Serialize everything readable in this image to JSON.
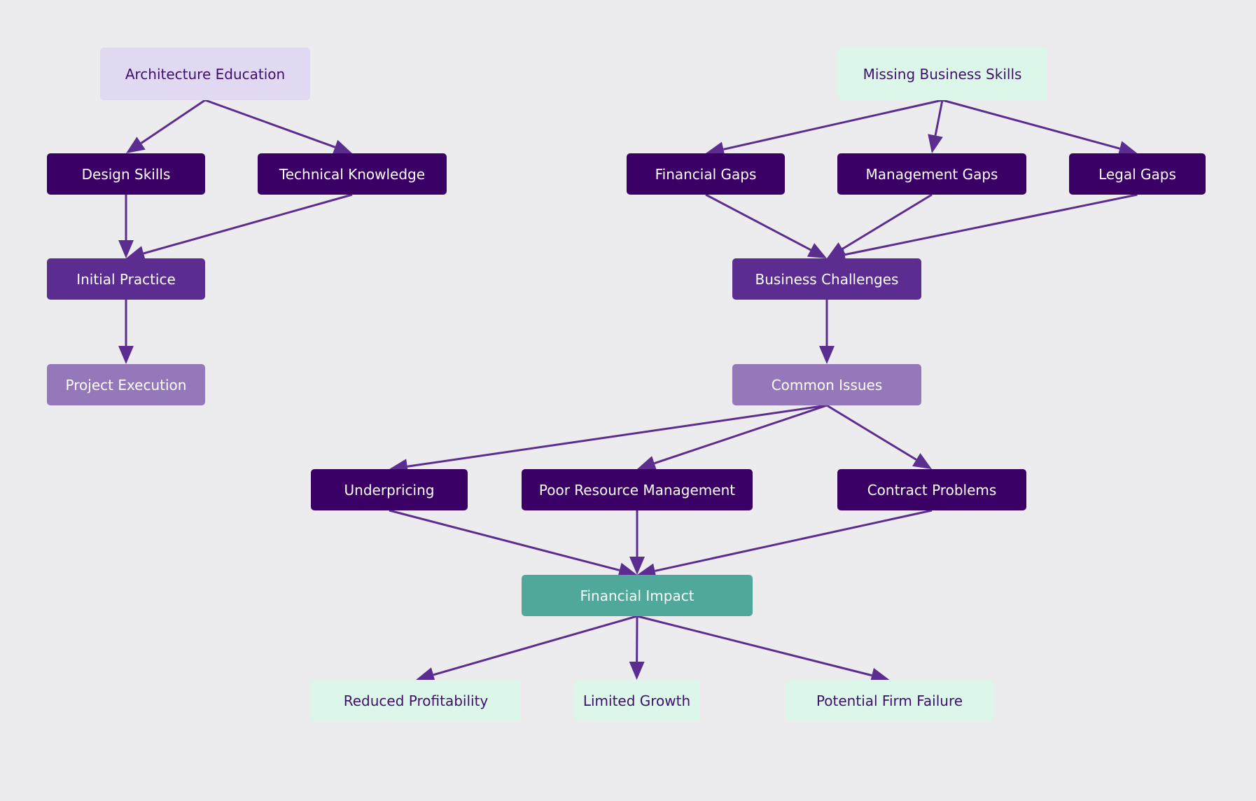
{
  "colors": {
    "background": "#ececef",
    "edge": "#5c2d91",
    "lavender": "#e1d9f1",
    "mint": "#dcf7ea",
    "dark": "#3b0066",
    "medium": "#5c2d91",
    "light": "#9578ba",
    "teal": "#4fa899"
  },
  "nodes": {
    "arch_edu": {
      "label": "Architecture Education",
      "style": "lavender"
    },
    "design": {
      "label": "Design Skills",
      "style": "dark"
    },
    "technical": {
      "label": "Technical Knowledge",
      "style": "dark"
    },
    "initial": {
      "label": "Initial Practice",
      "style": "medium"
    },
    "project": {
      "label": "Project Execution",
      "style": "light"
    },
    "missing": {
      "label": "Missing Business Skills",
      "style": "mint"
    },
    "fin_gaps": {
      "label": "Financial Gaps",
      "style": "dark"
    },
    "mgmt_gaps": {
      "label": "Management Gaps",
      "style": "dark"
    },
    "legal_gaps": {
      "label": "Legal Gaps",
      "style": "dark"
    },
    "biz_chal": {
      "label": "Business Challenges",
      "style": "medium"
    },
    "common": {
      "label": "Common Issues",
      "style": "light"
    },
    "underpricing": {
      "label": "Underpricing",
      "style": "dark"
    },
    "poor_res": {
      "label": "Poor Resource Management",
      "style": "dark"
    },
    "contract": {
      "label": "Contract Problems",
      "style": "dark"
    },
    "fin_impact": {
      "label": "Financial Impact",
      "style": "teal"
    },
    "reduced": {
      "label": "Reduced Profitability",
      "style": "mint"
    },
    "limited": {
      "label": "Limited Growth",
      "style": "mint"
    },
    "failure": {
      "label": "Potential Firm Failure",
      "style": "mint"
    }
  },
  "edges": [
    [
      "arch_edu",
      "design"
    ],
    [
      "arch_edu",
      "technical"
    ],
    [
      "design",
      "initial"
    ],
    [
      "technical",
      "initial"
    ],
    [
      "initial",
      "project"
    ],
    [
      "missing",
      "fin_gaps"
    ],
    [
      "missing",
      "mgmt_gaps"
    ],
    [
      "missing",
      "legal_gaps"
    ],
    [
      "fin_gaps",
      "biz_chal"
    ],
    [
      "mgmt_gaps",
      "biz_chal"
    ],
    [
      "legal_gaps",
      "biz_chal"
    ],
    [
      "biz_chal",
      "common"
    ],
    [
      "common",
      "underpricing"
    ],
    [
      "common",
      "poor_res"
    ],
    [
      "common",
      "contract"
    ],
    [
      "underpricing",
      "fin_impact"
    ],
    [
      "poor_res",
      "fin_impact"
    ],
    [
      "contract",
      "fin_impact"
    ],
    [
      "fin_impact",
      "reduced"
    ],
    [
      "fin_impact",
      "limited"
    ],
    [
      "fin_impact",
      "failure"
    ]
  ]
}
